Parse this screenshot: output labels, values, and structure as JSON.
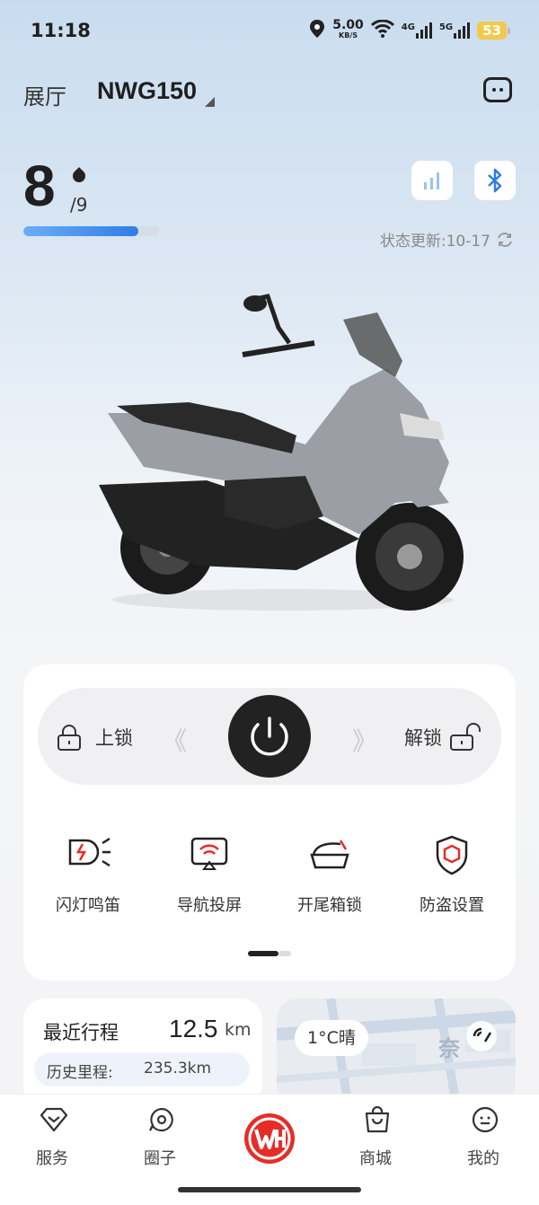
{
  "status": {
    "time": "11:18",
    "speed_value": "5.00",
    "speed_unit": "KB/S",
    "net1": "4G",
    "net2": "5G",
    "battery": "53"
  },
  "header": {
    "showroom": "展厅",
    "model": "NWG150"
  },
  "fuel": {
    "level": "8",
    "total": "/9",
    "fraction": 0.85
  },
  "update": {
    "text": "状态更新:10-17"
  },
  "lock": {
    "lock_label": "上锁",
    "unlock_label": "解锁",
    "left_chevron": "《",
    "right_chevron": "》"
  },
  "functions": [
    {
      "label": "闪灯鸣笛",
      "icon": "flash-horn-icon"
    },
    {
      "label": "导航投屏",
      "icon": "nav-cast-icon"
    },
    {
      "label": "开尾箱锁",
      "icon": "trunk-icon"
    },
    {
      "label": "防盗设置",
      "icon": "anti-theft-icon"
    }
  ],
  "trip": {
    "title": "最近行程",
    "value": "12.5",
    "unit": "km",
    "history_label": "历史里程:",
    "history_value": "235.3km"
  },
  "map": {
    "weather": "1°C晴",
    "place_partial": "奈"
  },
  "tabs": [
    {
      "label": "服务",
      "icon": "service-icon"
    },
    {
      "label": "圈子",
      "icon": "circle-icon"
    },
    {
      "label": "",
      "icon": "brand-logo-icon"
    },
    {
      "label": "商城",
      "icon": "shop-icon"
    },
    {
      "label": "我的",
      "icon": "profile-icon"
    }
  ],
  "colors": {
    "accent": "#e52d27",
    "blue": "#2f7de6"
  }
}
